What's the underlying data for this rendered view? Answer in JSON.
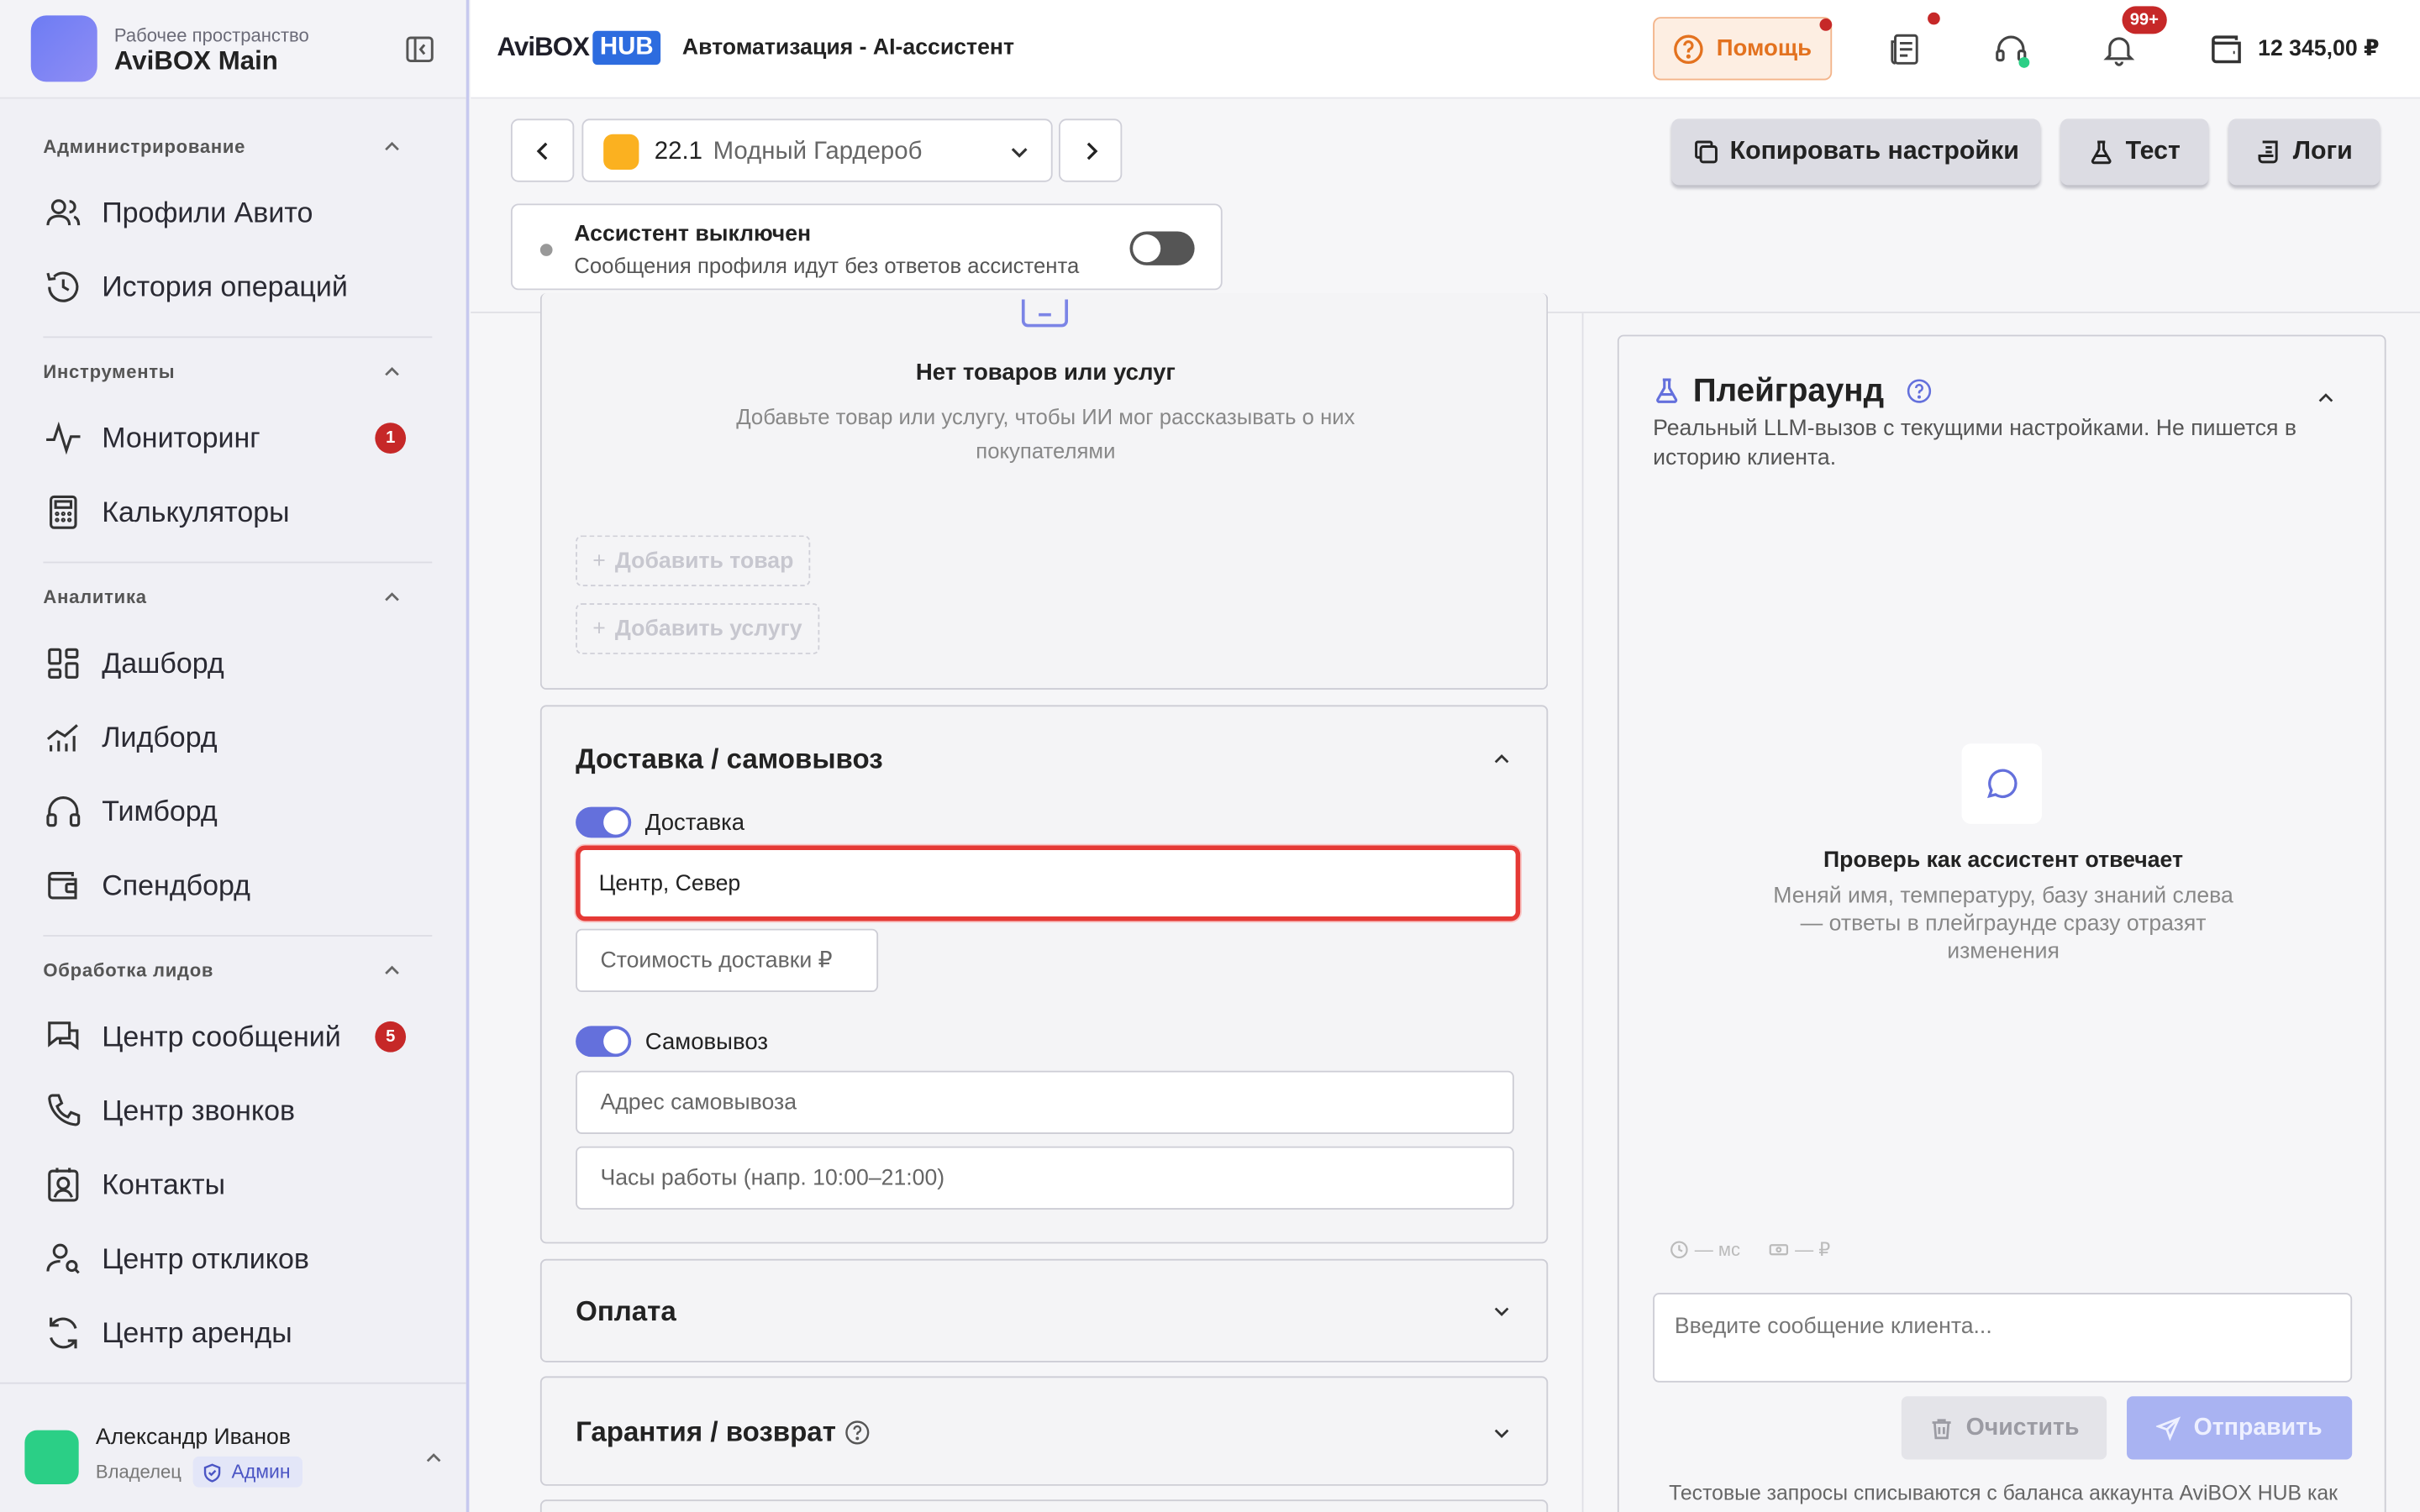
{
  "workspace": {
    "label": "Рабочее пространство",
    "name": "AviBOX Main"
  },
  "sidebar": {
    "sections": [
      {
        "title": "Администрирование",
        "items": [
          {
            "label": "Профили Авито",
            "icon": "users-icon"
          },
          {
            "label": "История операций",
            "icon": "history-icon"
          }
        ]
      },
      {
        "title": "Инструменты",
        "items": [
          {
            "label": "Мониторинг",
            "icon": "activity-icon",
            "badge": "1"
          },
          {
            "label": "Калькуляторы",
            "icon": "calculator-icon"
          }
        ]
      },
      {
        "title": "Аналитика",
        "items": [
          {
            "label": "Дашборд",
            "icon": "dashboard-icon"
          },
          {
            "label": "Лидборд",
            "icon": "chart-icon"
          },
          {
            "label": "Тимборд",
            "icon": "headphones-icon"
          },
          {
            "label": "Спендборд",
            "icon": "wallet-icon"
          }
        ]
      },
      {
        "title": "Обработка лидов",
        "items": [
          {
            "label": "Центр сообщений",
            "icon": "messages-icon",
            "badge": "5"
          },
          {
            "label": "Центр звонков",
            "icon": "phone-icon"
          },
          {
            "label": "Контакты",
            "icon": "contacts-icon"
          },
          {
            "label": "Центр откликов",
            "icon": "user-search-icon"
          },
          {
            "label": "Центр аренды",
            "icon": "refresh-icon"
          }
        ]
      }
    ]
  },
  "user": {
    "name": "Александр Иванов",
    "role": "Владелец",
    "tag": "Админ"
  },
  "topbar": {
    "logo_text": "AviBOX",
    "logo_badge": "HUB",
    "title": "Автоматизация - AI-ассистент",
    "help": "Помощь",
    "notifications": "99+",
    "balance": "12 345,00 ₽"
  },
  "profile": {
    "number": "22.1",
    "name": "Модный Гардероб"
  },
  "toolbar": {
    "copy": "Копировать настройки",
    "test": "Тест",
    "logs": "Логи"
  },
  "assistant": {
    "title": "Ассистент выключен",
    "subtitle": "Сообщения профиля идут без ответов ассистента",
    "enabled": false
  },
  "products": {
    "empty_title": "Нет товаров или услуг",
    "empty_sub": "Добавьте товар или услугу, чтобы ИИ мог рассказывать о них покупателями",
    "add_product": "Добавить товар",
    "add_service": "Добавить услугу"
  },
  "delivery": {
    "title": "Доставка / самовывоз",
    "delivery_label": "Доставка",
    "delivery_enabled": true,
    "zones_value": "Центр, Север",
    "cost_placeholder": "Стоимость доставки ₽",
    "pickup_label": "Самовывоз",
    "pickup_enabled": true,
    "address_placeholder": "Адрес самовывоза",
    "hours_placeholder": "Часы работы (напр. 10:00–21:00)"
  },
  "sections": {
    "payment": "Оплата",
    "warranty": "Гарантия / возврат"
  },
  "playground": {
    "title": "Плейграунд",
    "desc": "Реальный LLM-вызов с текущими настройками. Не пишется в историю клиента.",
    "empty_title": "Проверь как ассистент отвечает",
    "empty_line1": "Меняй имя, температуру, базу знаний слева",
    "empty_line2": "— ответы в плейграунде сразу отразят",
    "empty_line3": "изменения",
    "latency": "— мс",
    "cost": "— ₽",
    "input_placeholder": "Введите сообщение клиента...",
    "clear": "Очистить",
    "send": "Отправить",
    "footer": "Тестовые запросы списываются с баланса аккаунта AviBOX HUB как"
  },
  "colors": {
    "accent": "#6470dc",
    "danger": "#e53935",
    "help": "#e3721f",
    "brand": "#2d6cdf"
  }
}
